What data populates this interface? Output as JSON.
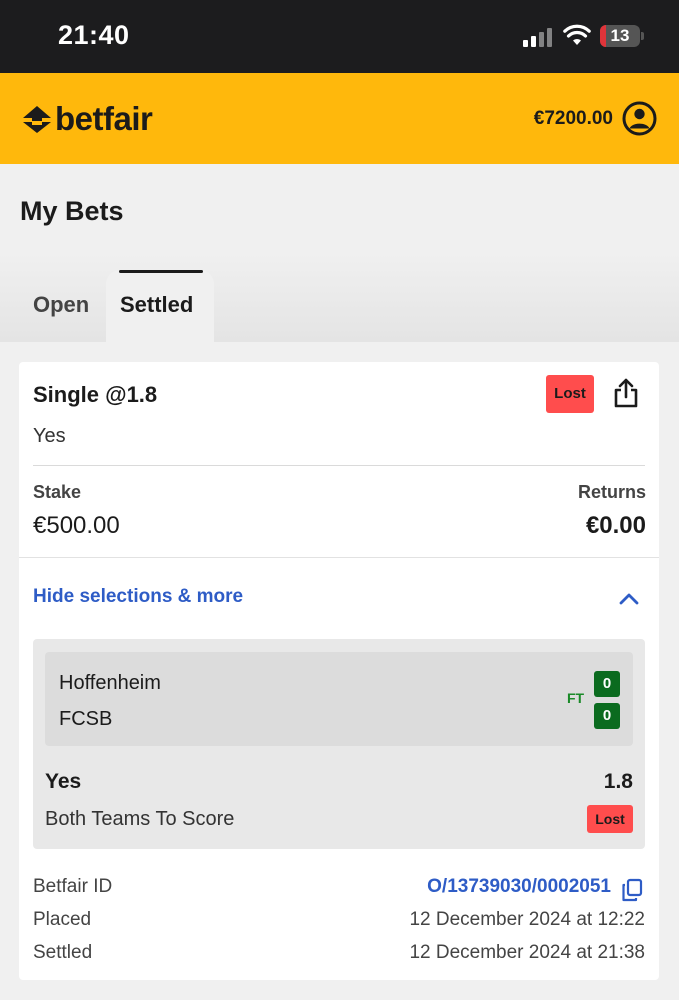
{
  "status_bar": {
    "time": "21:40",
    "battery": "13"
  },
  "header": {
    "brand": "betfair",
    "balance": "€7200.00"
  },
  "page": {
    "title": "My Bets"
  },
  "tabs": [
    {
      "label": "Open",
      "active": false
    },
    {
      "label": "Settled",
      "active": true
    }
  ],
  "bet": {
    "title": "Single @1.8",
    "status": "Lost",
    "selection": "Yes",
    "stake_label": "Stake",
    "stake": "€500.00",
    "returns_label": "Returns",
    "returns": "€0.00",
    "toggle_label": "Hide selections & more",
    "event": {
      "home": "Hoffenheim",
      "away": "FCSB",
      "period": "FT",
      "home_score": "0",
      "away_score": "0"
    },
    "outcome": "Yes",
    "odds": "1.8",
    "market": "Both Teams To Score",
    "leg_status": "Lost",
    "details": {
      "id_label": "Betfair ID",
      "id": "O/13739030/0002051",
      "placed_label": "Placed",
      "placed": "12 December 2024 at 12:22",
      "settled_label": "Settled",
      "settled": "12 December 2024 at 21:38"
    }
  },
  "colors": {
    "brand_yellow": "#ffb80c",
    "lost_red": "#ff4d4d",
    "link_blue": "#2e5cc6",
    "score_green": "#0b6b1f"
  },
  "icons": [
    "signal-icon",
    "wifi-icon",
    "battery-icon",
    "betfair-logo-icon",
    "account-icon",
    "share-icon",
    "chevron-up-icon",
    "copy-icon"
  ]
}
